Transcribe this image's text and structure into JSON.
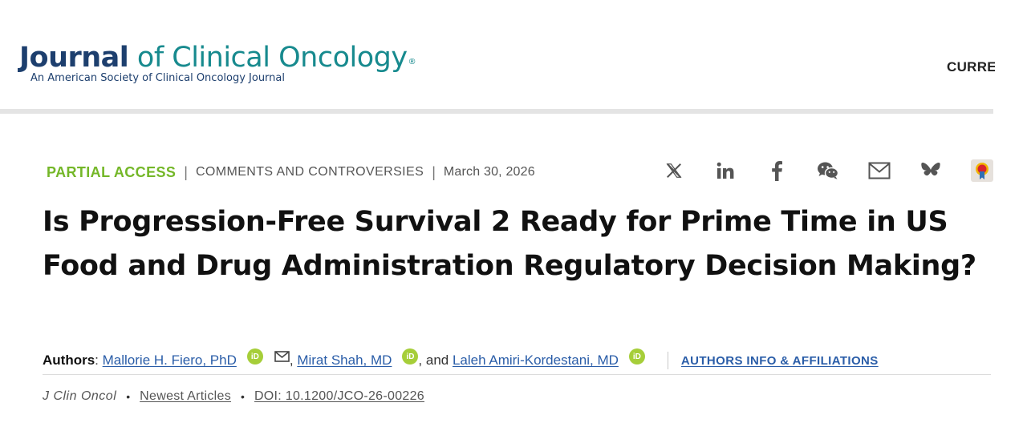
{
  "header": {
    "logo_word_bold": "Journal",
    "logo_word_rest": " of Clinical Oncology",
    "logo_registered": "®",
    "logo_subtitle": "An American Society of Clinical Oncology Journal",
    "nav_current": "CURRE"
  },
  "article": {
    "access": "PARTIAL ACCESS",
    "separator": "|",
    "type": "COMMENTS AND CONTROVERSIES",
    "date": "March 30, 2026",
    "title": "Is Progression-Free Survival 2 Ready for Prime Time in US Food and Drug Administration Regulatory Decision Making?"
  },
  "share": {
    "icons": [
      "x-icon",
      "linkedin-icon",
      "facebook-icon",
      "wechat-icon",
      "email-icon",
      "bluesky-icon",
      "mendeley-icon"
    ]
  },
  "authors": {
    "label": "Authors",
    "colon": ":",
    "list": [
      {
        "name": "Mallorie H. Fiero, PhD"
      },
      {
        "name": "Mirat Shah, MD"
      },
      {
        "name": "Laleh Amiri-Kordestani, MD"
      }
    ],
    "comma": " ,",
    "and": " , and",
    "orcid_label": "iD",
    "affiliations_link": "AUTHORS INFO & AFFILIATIONS"
  },
  "citation": {
    "journal": "J Clin Oncol",
    "bullet": "•",
    "section": "Newest Articles",
    "doi": "DOI: 10.1200/JCO-26-00226"
  },
  "colors": {
    "access_green": "#74b728",
    "link_blue": "#2a5da8",
    "logo_navy": "#1d3f6e",
    "logo_teal": "#178a8e",
    "orcid_green": "#a6ce39"
  }
}
